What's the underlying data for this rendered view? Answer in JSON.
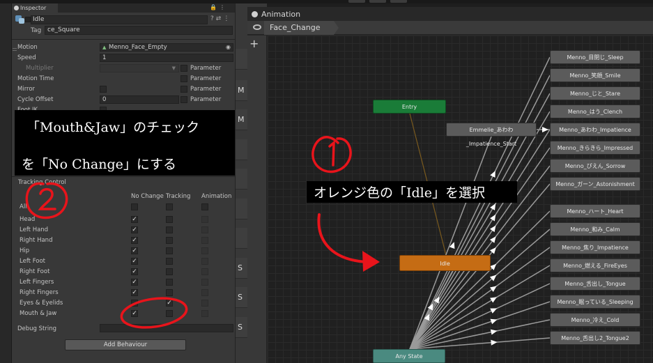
{
  "inspector": {
    "tab_label": "Inspector",
    "object_name": "Idle",
    "tag_label": "Tag",
    "tag_value": "ce_Square",
    "props": [
      {
        "label": "Motion",
        "value": "Menno_Face_Empty"
      },
      {
        "label": "Speed",
        "value": "1"
      },
      {
        "label": "Multiplier",
        "param": "Parameter"
      },
      {
        "label": "Motion Time",
        "param": "Parameter"
      },
      {
        "label": "Mirror",
        "param": "Parameter"
      },
      {
        "label": "Cycle Offset",
        "value": "0",
        "param": "Parameter"
      },
      {
        "label": "Foot IK"
      }
    ],
    "tracking": {
      "title": "Tracking Control",
      "headers": [
        "No Change",
        "Tracking",
        "Animation"
      ],
      "all_label": "All",
      "check_mark": "✓",
      "rows": [
        {
          "label": "Head",
          "nochange": true,
          "tracking": false
        },
        {
          "label": "Left Hand",
          "nochange": true,
          "tracking": false
        },
        {
          "label": "Right Hand",
          "nochange": true,
          "tracking": false
        },
        {
          "label": "Hip",
          "nochange": true,
          "tracking": false
        },
        {
          "label": "Left Foot",
          "nochange": true,
          "tracking": false
        },
        {
          "label": "Right Foot",
          "nochange": true,
          "tracking": false
        },
        {
          "label": "Left Fingers",
          "nochange": true,
          "tracking": false
        },
        {
          "label": "Right Fingers",
          "nochange": true,
          "tracking": false
        },
        {
          "label": "Eyes & Eyelids",
          "nochange": false,
          "tracking": true
        },
        {
          "label": "Mouth & Jaw",
          "nochange": true,
          "tracking": false
        }
      ]
    },
    "debug_label": "Debug String",
    "add_behaviour": "Add Behaviour"
  },
  "column_rows": [
    {
      "mark": ""
    },
    {
      "mark": "M"
    },
    {
      "mark": "M"
    },
    {
      "mark": ""
    },
    {
      "mark": ""
    },
    {
      "mark": ""
    },
    {
      "mark": ""
    },
    {
      "mark": "S"
    },
    {
      "mark": "S"
    },
    {
      "mark": "S"
    }
  ],
  "animation": {
    "title": "Animation",
    "layer": "Face_Change",
    "states": {
      "entry": "Entry",
      "idle": "Idle",
      "any": "Any State",
      "emmelie": "Emmelie_あわわ_Impatience_Start",
      "right": [
        "Menno_目閉じ_Sleep",
        "Menno_笑顔_Smile",
        "Menno_じと_Stare",
        "Menno_はう_Clench",
        "Menno_あわわ_Impatience",
        "Menno_きらきら_Impressed",
        "Menno_ぴえん_Sorrow",
        "Menno_ガーン_Astonishment",
        "Menno_ハート_Heart",
        "Menno_和み_Calm",
        "Menno_焦り_Impatience",
        "Menno_燃える_FireEyes",
        "Menno_舌出し_Tongue",
        "Menno_眠っている_Sleeping",
        "Menno_冷え_Cold",
        "Menno_舌出し2_Tongue2"
      ]
    }
  },
  "annotations": {
    "instruction_1_line1": "「Mouth&Jaw」のチェック",
    "instruction_1_line2": "を「No Change」にする",
    "instruction_2": "オレンジ色の「Idle」を選択",
    "step_1": "①",
    "step_2": "②"
  },
  "colors": {
    "annotation_red": "#e8141b",
    "idle_orange": "#c56c14",
    "entry_green": "#1a7c38",
    "any_state_teal": "#4a8a80"
  }
}
